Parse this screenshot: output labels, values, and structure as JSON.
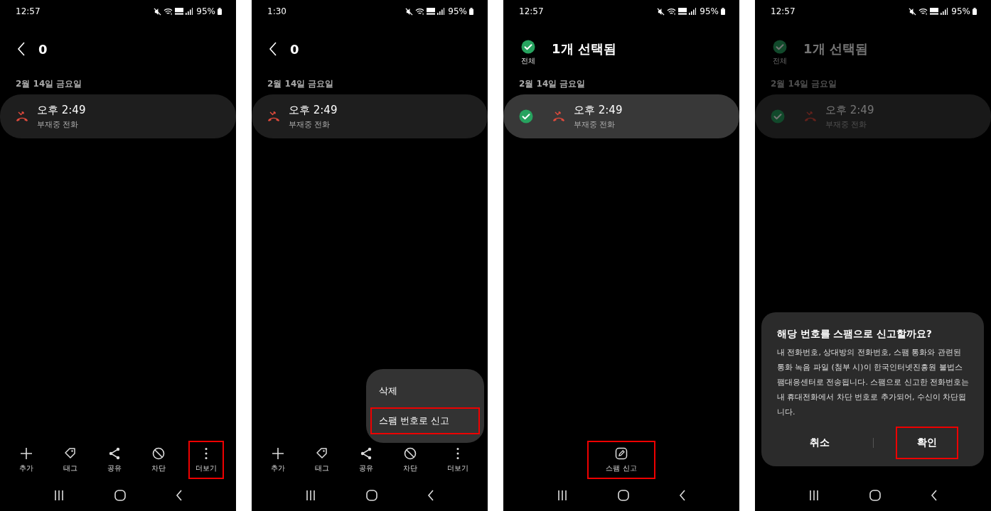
{
  "screens": [
    {
      "status_bar": {
        "time": "12:57",
        "battery": "95%"
      },
      "header": {
        "kind": "back",
        "title": "0"
      },
      "date": "2월 14일 금요일",
      "calls": [
        {
          "time": "오후 2:49",
          "type": "부재중 전화",
          "selected": false
        }
      ],
      "toolbar": [
        {
          "kind": "plus",
          "label": "추가",
          "highlighted": false
        },
        {
          "kind": "tag",
          "label": "태그",
          "highlighted": false
        },
        {
          "kind": "share",
          "label": "공유",
          "highlighted": false
        },
        {
          "kind": "block",
          "label": "차단",
          "highlighted": false
        },
        {
          "kind": "more",
          "label": "더보기",
          "highlighted": true
        }
      ],
      "dimmed": false
    },
    {
      "status_bar": {
        "time": "1:30",
        "battery": "95%"
      },
      "header": {
        "kind": "back",
        "title": "0"
      },
      "date": "2월 14일 금요일",
      "calls": [
        {
          "time": "오후 2:49",
          "type": "부재중 전화",
          "selected": false
        }
      ],
      "menu": [
        {
          "label": "삭제",
          "highlighted": false
        },
        {
          "label": "스팸 번호로 신고",
          "highlighted": true
        }
      ],
      "toolbar": [
        {
          "kind": "plus",
          "label": "추가",
          "highlighted": false
        },
        {
          "kind": "tag",
          "label": "태그",
          "highlighted": false
        },
        {
          "kind": "share",
          "label": "공유",
          "highlighted": false
        },
        {
          "kind": "block",
          "label": "차단",
          "highlighted": false
        },
        {
          "kind": "more",
          "label": "더보기",
          "highlighted": false
        }
      ],
      "dimmed": false
    },
    {
      "status_bar": {
        "time": "12:57",
        "battery": "95%"
      },
      "header": {
        "kind": "selection",
        "all_label": "전체",
        "all_checked": true,
        "title": "1개 선택됨"
      },
      "date": "2월 14일 금요일",
      "calls": [
        {
          "time": "오후 2:49",
          "type": "부재중 전화",
          "selected": true,
          "checked": true
        }
      ],
      "toolbar": [
        {
          "kind": "edit",
          "label": "스팸 신고",
          "highlighted": true
        }
      ],
      "dimmed": false
    },
    {
      "status_bar": {
        "time": "12:57",
        "battery": "95%"
      },
      "header": {
        "kind": "selection",
        "all_label": "전체",
        "all_checked": true,
        "title": "1개 선택됨"
      },
      "date": "2월 14일 금요일",
      "calls": [
        {
          "time": "오후 2:49",
          "type": "부재중 전화",
          "selected": true,
          "checked": true
        }
      ],
      "dialog": {
        "title": "해당 번호를 스팸으로 신고할까요?",
        "body": "내 전화번호, 상대방의 전화번호, 스팸 통화와 관련된 통화 녹음 파일 (첨부 시)이 한국인터넷진흥원 불법스팸대응센터로 전송됩니다. 스팸으로 신고한 전화번호는 내 휴대전화에서 차단 번호로 추가되어, 수신이 차단됩니다.",
        "buttons": [
          {
            "label": "취소",
            "highlighted": false
          },
          {
            "label": "확인",
            "highlighted": true
          }
        ]
      },
      "dimmed": true
    }
  ]
}
